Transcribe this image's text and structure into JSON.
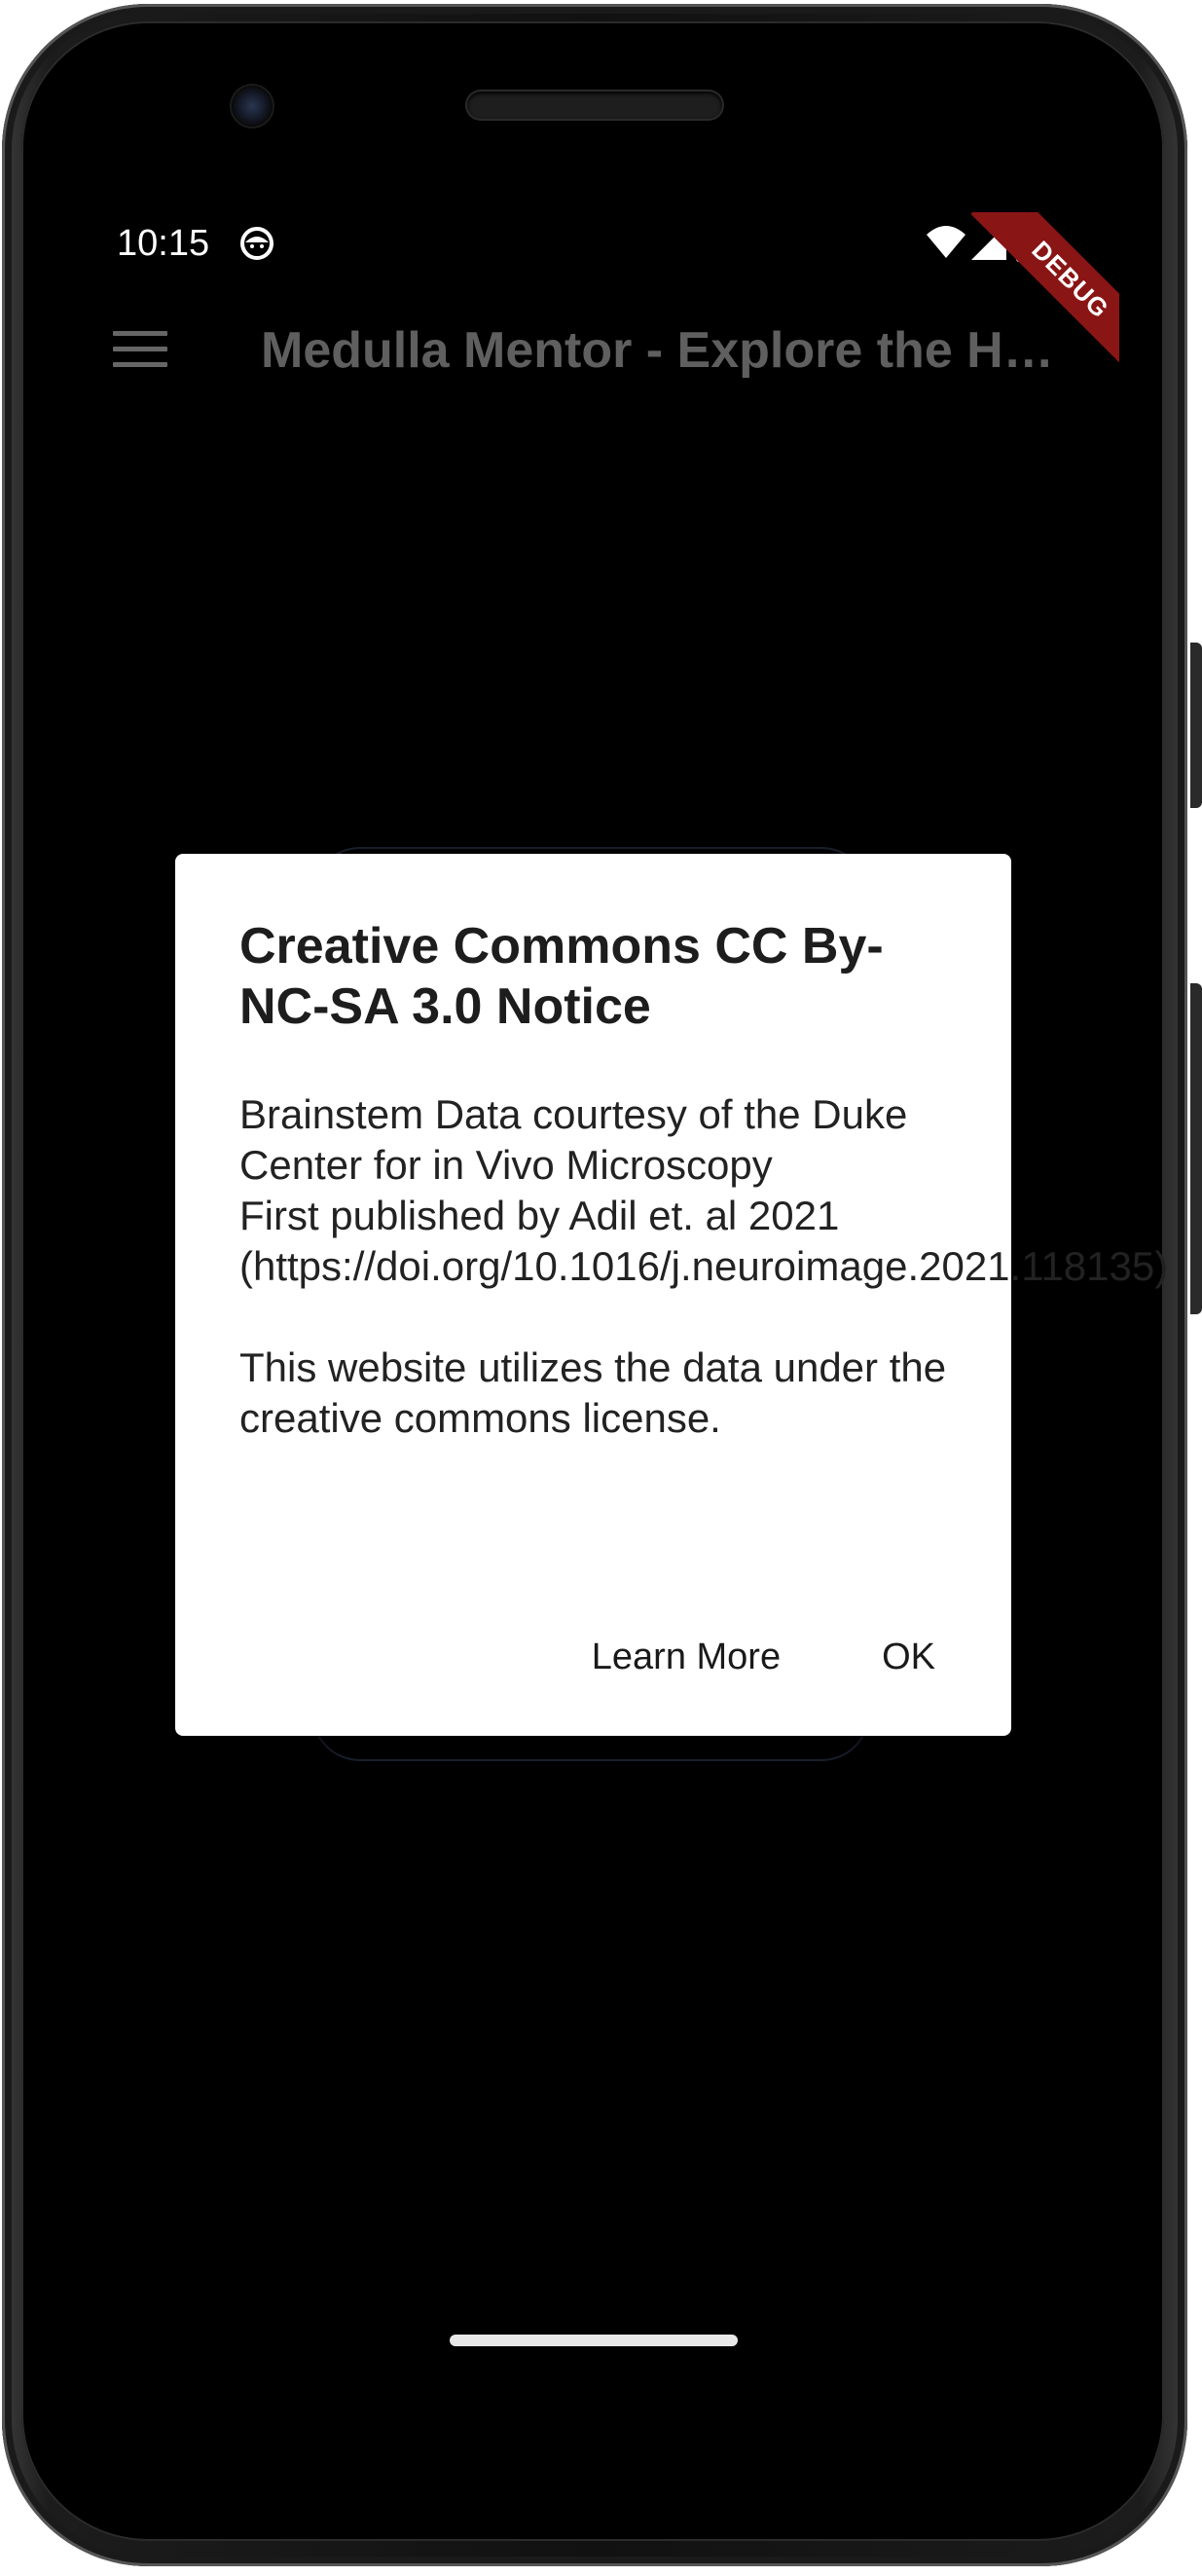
{
  "status_bar": {
    "time": "10:15",
    "notification_icon": "cat-face-icon",
    "wifi_icon": "wifi-icon",
    "signal_icon": "cell-signal-icon",
    "battery_icon": "battery-icon"
  },
  "debug_banner": {
    "label": "DEBUG"
  },
  "app_bar": {
    "menu_icon": "hamburger-menu-icon",
    "title": "Medulla Mentor - Explore the Human Brainstem"
  },
  "dialog": {
    "title": "Creative Commons CC By-NC-SA 3.0 Notice",
    "body_lines": [
      "Brainstem Data courtesy of the Duke Center for in Vivo Microscopy",
      "First published by Adil et. al 2021",
      "(https://doi.org/10.1016/j.neuroimage.2021.118135)",
      "This website utilizes the data under the creative commons license."
    ],
    "actions": {
      "learn_more": "Learn More",
      "ok": "OK"
    }
  },
  "colors": {
    "screen_background": "#000000",
    "dialog_background": "#ffffff",
    "debug_ribbon": "#8a1515",
    "app_title": "#5f5f5f"
  }
}
